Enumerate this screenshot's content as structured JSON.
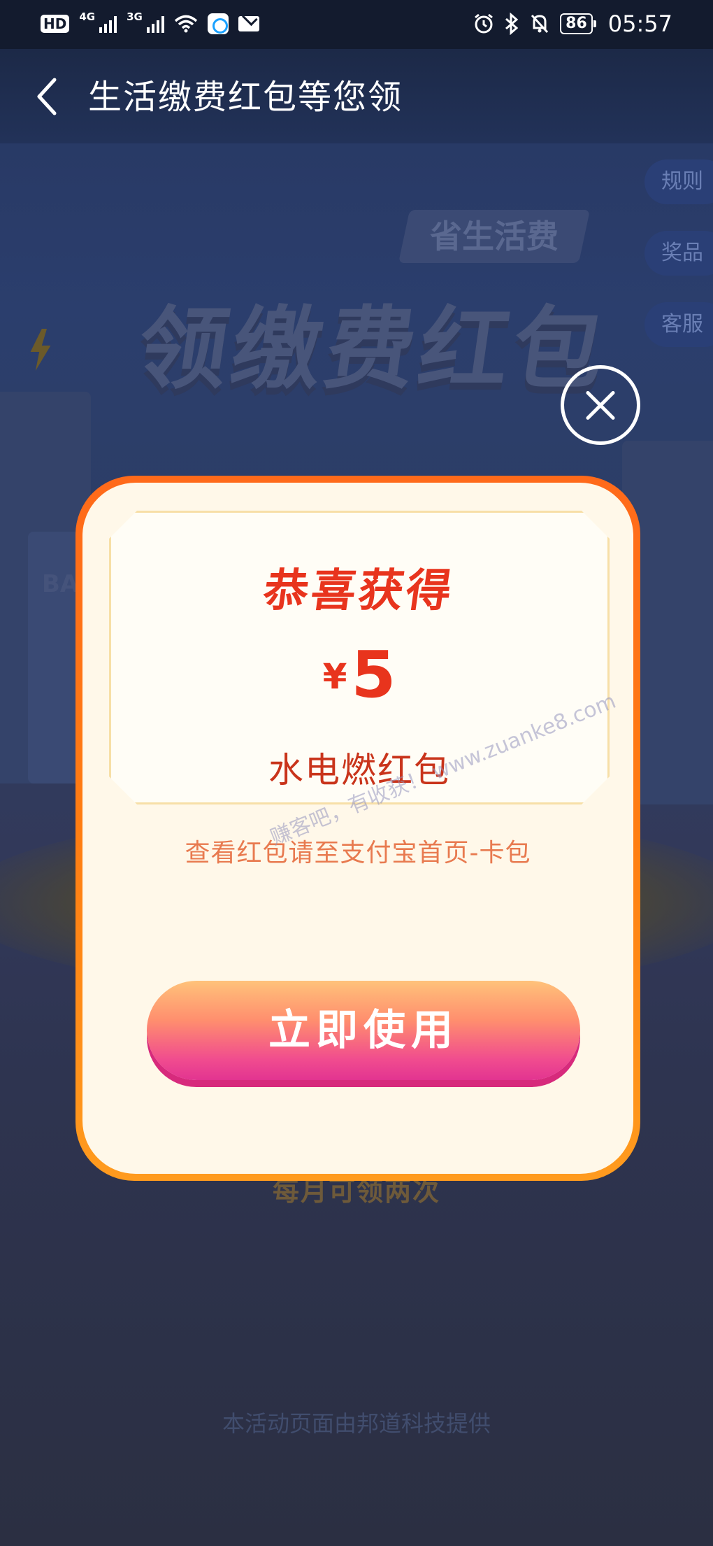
{
  "status_bar": {
    "hd_label": "HD",
    "network_1": "4G",
    "network_2": "3G",
    "battery": "86",
    "time": "05:57"
  },
  "nav": {
    "title": "生活缴费红包等您领"
  },
  "side_menu": [
    {
      "label": "规则"
    },
    {
      "label": "奖品"
    },
    {
      "label": "客服"
    }
  ],
  "banner": {
    "tag": "省生活费",
    "title": "领缴费红包"
  },
  "background": {
    "monthly_note": "每月可领两次",
    "footer": "本活动页面由邦道科技提供",
    "building_logo": "BA"
  },
  "modal": {
    "title": "恭喜获得",
    "currency": "¥",
    "amount": "5",
    "prize_name": "水电燃红包",
    "hint": "查看红包请至支付宝首页-卡包",
    "use_button": "立即使用"
  },
  "watermark": "赚客吧，有收获！ www.zuanke8.com",
  "colors": {
    "accent_red": "#e8341d",
    "modal_border": "#ff7d12",
    "button_gradient_end": "#e23490"
  },
  "icons": [
    "hd-icon",
    "signal-icon",
    "wifi-icon",
    "app-icon",
    "mail-icon",
    "alarm-icon",
    "bluetooth-icon",
    "mute-icon",
    "battery-icon",
    "back-arrow-icon",
    "close-icon"
  ]
}
